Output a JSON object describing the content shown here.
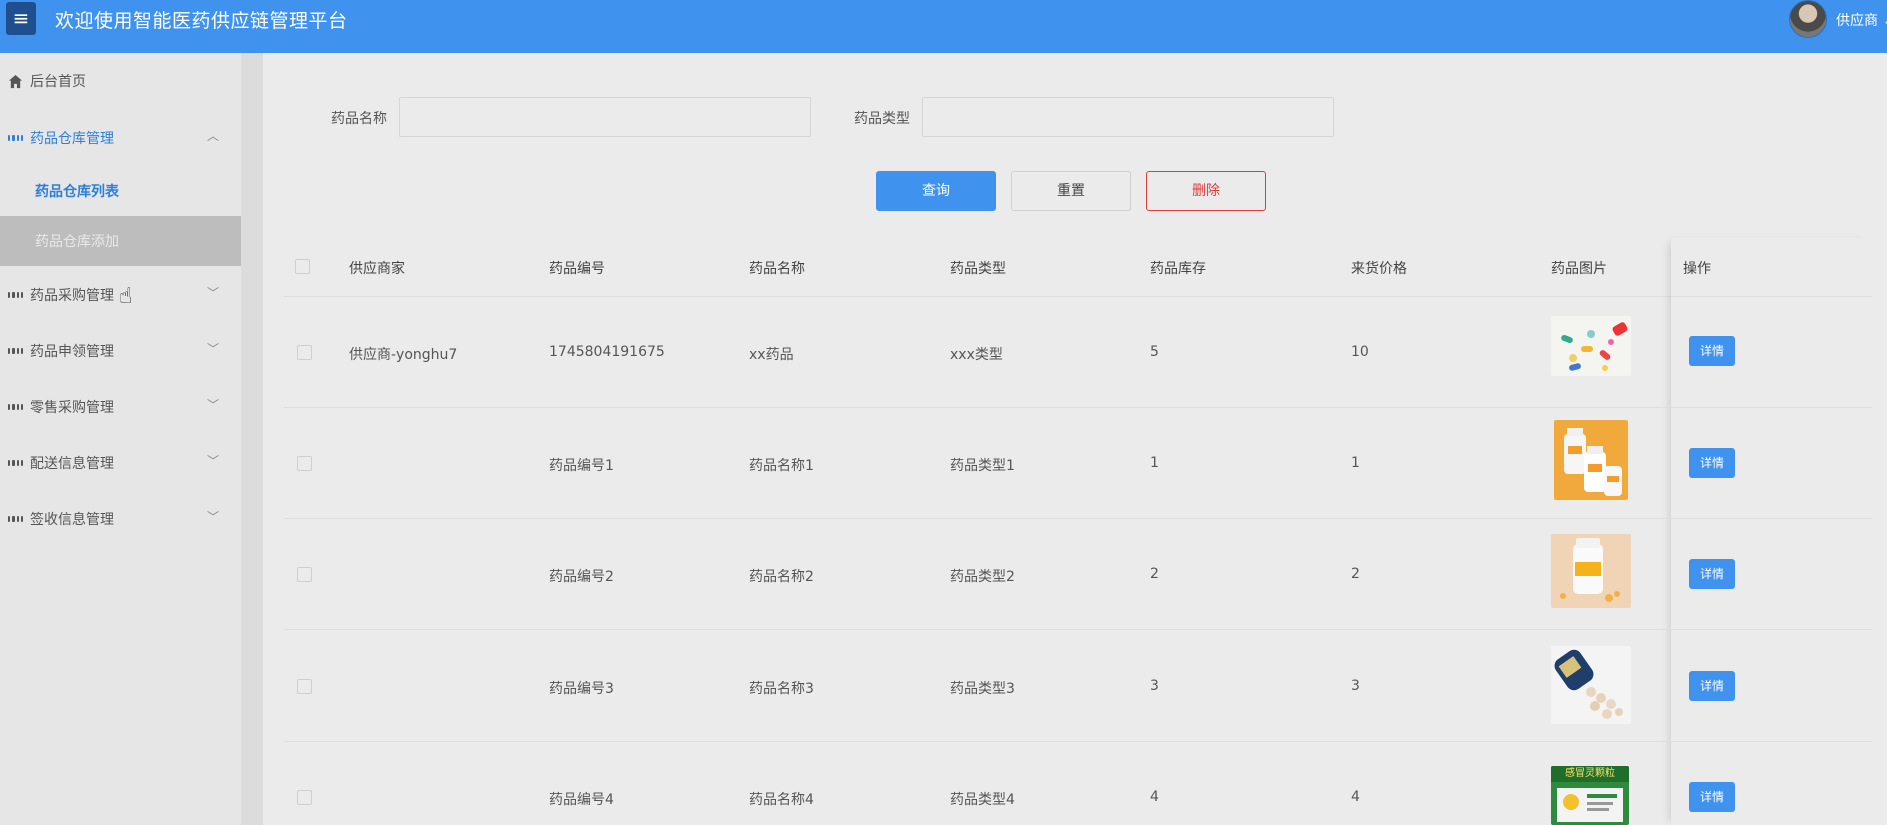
{
  "header": {
    "menu_icon": "hamburger-icon",
    "title": "欢迎使用智能医药供应链管理平台",
    "user": "供应商"
  },
  "sidebar": {
    "home": "后台首页",
    "groups": [
      {
        "label": "药品仓库管理",
        "expanded": true,
        "children": [
          "药品仓库列表",
          "药品仓库添加"
        ]
      },
      {
        "label": "药品采购管理"
      },
      {
        "label": "药品申领管理"
      },
      {
        "label": "零售采购管理"
      },
      {
        "label": "配送信息管理"
      },
      {
        "label": "签收信息管理"
      }
    ]
  },
  "search": {
    "name_label": "药品名称",
    "type_label": "药品类型",
    "name_value": "",
    "type_value": ""
  },
  "actions": {
    "query": "查询",
    "reset": "重置",
    "delete": "删除"
  },
  "table": {
    "columns": [
      "供应商家",
      "药品编号",
      "药品名称",
      "药品类型",
      "药品库存",
      "来货价格",
      "药品图片",
      "操作"
    ],
    "detail_label": "详情",
    "rows": [
      {
        "supplier": "供应商-yonghu7",
        "code": "1745804191675",
        "name": "xx药品",
        "type": "xxx类型",
        "stock": "5",
        "price": "10"
      },
      {
        "supplier": "",
        "code": "药品编号1",
        "name": "药品名称1",
        "type": "药品类型1",
        "stock": "1",
        "price": "1"
      },
      {
        "supplier": "",
        "code": "药品编号2",
        "name": "药品名称2",
        "type": "药品类型2",
        "stock": "2",
        "price": "2"
      },
      {
        "supplier": "",
        "code": "药品编号3",
        "name": "药品名称3",
        "type": "药品类型3",
        "stock": "3",
        "price": "3"
      },
      {
        "supplier": "",
        "code": "药品编号4",
        "name": "药品名称4",
        "type": "药品类型4",
        "stock": "4",
        "price": "4"
      }
    ]
  },
  "image_texts": {
    "box_label": "感冒灵颗粒"
  },
  "colors": {
    "primary": "#3f93ee",
    "danger": "#e23b3b",
    "active_text": "#2f7fd8"
  }
}
